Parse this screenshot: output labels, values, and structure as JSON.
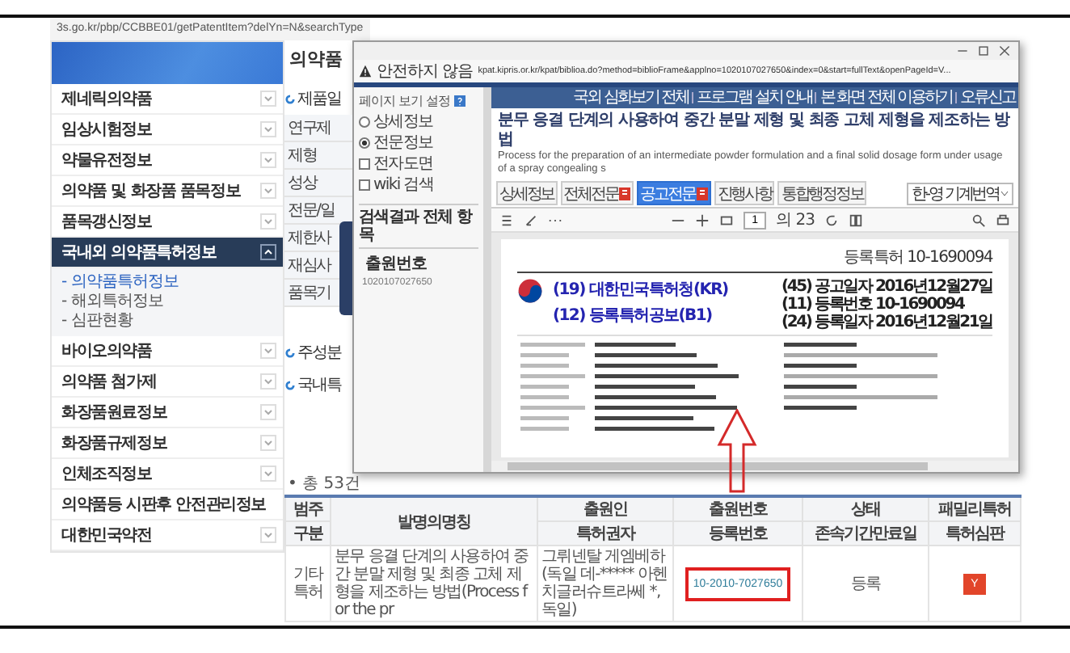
{
  "browser": {
    "url": "3s.go.kr/pbp/CCBBE01/getPatentItem?delYn=N&searchType"
  },
  "sidebar": {
    "items": [
      {
        "label": "제네릭의약품",
        "kind": "toggle",
        "expanded": false
      },
      {
        "label": "임상시험정보",
        "kind": "toggle",
        "expanded": false
      },
      {
        "label": "약물유전정보",
        "kind": "toggle",
        "expanded": false
      },
      {
        "label": "의약품 및 화장품 품목정보",
        "kind": "toggle",
        "expanded": false
      },
      {
        "label": "품목갱신정보",
        "kind": "toggle",
        "expanded": false
      },
      {
        "label": "국내외 의약품특허정보",
        "kind": "toggle",
        "expanded": true,
        "children": [
          {
            "label": "- 의약품특허정보",
            "selected": true
          },
          {
            "label": "- 해외특허정보",
            "selected": false
          },
          {
            "label": "- 심판현황",
            "selected": false
          }
        ]
      },
      {
        "label": "바이오의약품",
        "kind": "toggle",
        "expanded": false
      },
      {
        "label": "의약품 첨가제",
        "kind": "toggle",
        "expanded": false
      },
      {
        "label": "화장품원료정보",
        "kind": "toggle",
        "expanded": false
      },
      {
        "label": "화장품규제정보",
        "kind": "toggle",
        "expanded": false
      },
      {
        "label": "인체조직정보",
        "kind": "toggle",
        "expanded": false
      },
      {
        "label": "의약품등 시판후 안전관리정보",
        "kind": "plain",
        "expanded": false
      },
      {
        "label": "대한민국약전",
        "kind": "toggle",
        "expanded": false
      }
    ]
  },
  "main": {
    "heading": "의약품",
    "section": "제품일",
    "rows": [
      "연구제",
      "제형",
      "성상",
      "전문/일",
      "제한사",
      "재심사",
      "품목기"
    ],
    "sections_after": [
      "주성분",
      "국내특"
    ]
  },
  "popup": {
    "warning": "안전하지 않음",
    "address": "kpat.kipris.or.kr/kpat/biblioa.do?method=biblioFrame&applno=1020107027650&index=0&start=fullText&openPageId=V...",
    "panel": {
      "heading": "페이지 보기 설정",
      "views": [
        {
          "label": "상세정보",
          "selected": false
        },
        {
          "label": "전문정보",
          "selected": true
        }
      ],
      "options": [
        {
          "label": "전자도면",
          "checked": false
        },
        {
          "label": "wiki 검색",
          "checked": false
        }
      ],
      "results_heading": "검색결과 전체 항목",
      "field_label": "출원번호",
      "field_value": "1020107027650"
    },
    "links": [
      "국외 심화보기 전체",
      "프로그램 설치 안내",
      "본 화면 전체 이용하기",
      "오류신고"
    ],
    "title": "분무 응결 단계의 사용하여 중간 분말 제형 및 최종 고체 제형을 제조하는 방법",
    "title_en": "Process for the preparation of an intermediate powder formulation and a final solid dosage form under usage of a spray congealing s",
    "tabs": [
      {
        "label": "상세정보",
        "pdf": false,
        "selected": false
      },
      {
        "label": "전체전문",
        "pdf": true,
        "selected": false
      },
      {
        "label": "공고전문",
        "pdf": true,
        "selected": true
      },
      {
        "label": "진행사항",
        "pdf": false,
        "selected": false
      },
      {
        "label": "통합행정정보",
        "pdf": false,
        "selected": false
      }
    ],
    "translate": "한-영 기계번역",
    "page": "1",
    "page_count": "의 23",
    "document": {
      "doc_number": "등록특허 10-1690094",
      "office": "(19) 대한민국특허청(KR)",
      "publication": "(12) 등록특허공보(B1)",
      "meta": [
        {
          "code": "(45)",
          "label": "공고일자",
          "value": "2016년12월27일"
        },
        {
          "code": "(11)",
          "label": "등록번호",
          "value": "10-1690094"
        },
        {
          "code": "(24)",
          "label": "등록일자",
          "value": "2016년12월21일"
        }
      ]
    }
  },
  "table": {
    "total": "• 총 53건",
    "columns": [
      {
        "top": "범주",
        "bottom": "구분"
      },
      {
        "top": "발명의명칭"
      },
      {
        "top": "출원인",
        "bottom": "특허권자"
      },
      {
        "top": "출원번호",
        "bottom": "등록번호"
      },
      {
        "top": "상태",
        "bottom": "존속기간만료일"
      },
      {
        "top": "패밀리특허",
        "bottom": "특허심판"
      }
    ],
    "rows": [
      {
        "type": "기타특허",
        "title": "분무 응결 단계의 사용하여 중간 분말 제형 및 최종 고체 제형을 제조하는 방법(Process for the pr",
        "applicant": "그뤼넨탈 게엠베하 (독일 데-***** 아헨 치글러슈트라쎄 *, 독일)",
        "number": "10-2010-7027650",
        "highlighted": true,
        "status": "등록",
        "family": "Y"
      }
    ]
  }
}
